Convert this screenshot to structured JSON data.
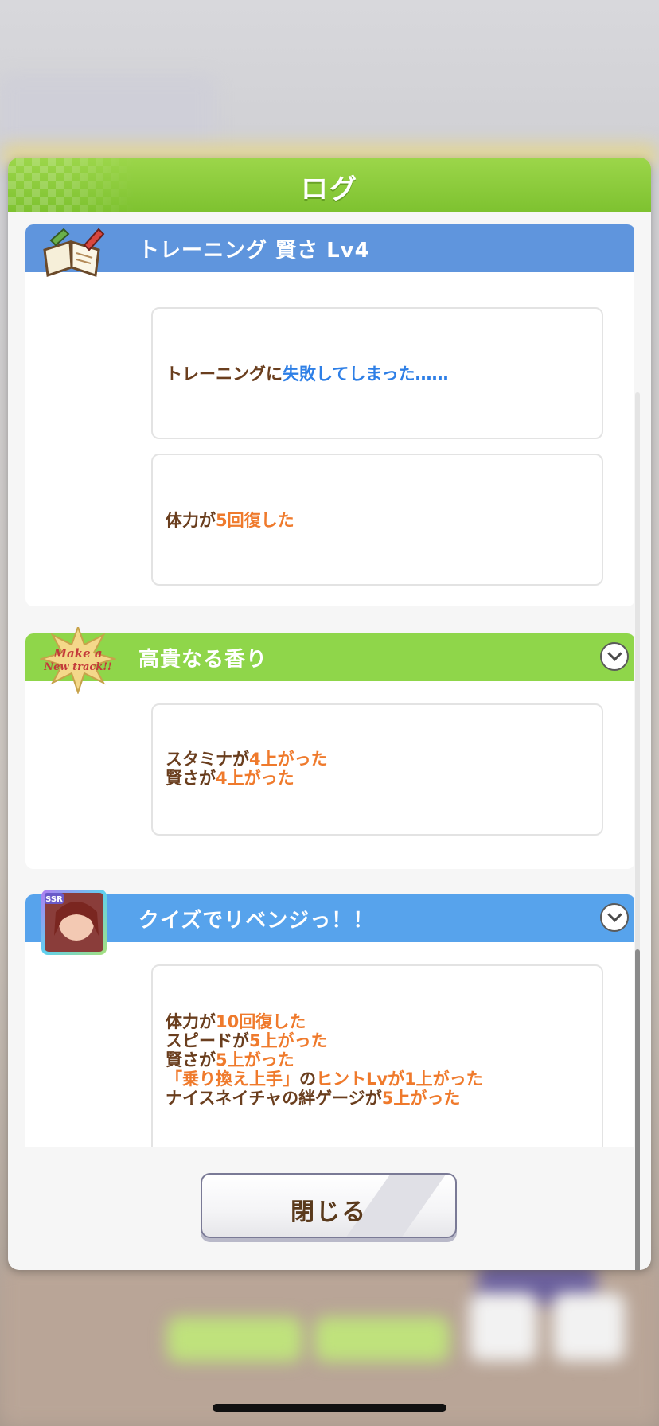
{
  "dialog": {
    "title": "ログ",
    "close_label": "閉じる"
  },
  "entries": [
    {
      "title": "トレーニング 賢さ Lv4",
      "header_color": "#5f95dd",
      "icon": "notebook-pencil-icon",
      "cards": [
        [
          [
            {
              "t": "トレーニングに",
              "c": "brown"
            },
            {
              "t": "失敗してしまった……",
              "c": "blue"
            }
          ]
        ],
        [
          [
            {
              "t": "体力が",
              "c": "brown"
            },
            {
              "t": "5回復した",
              "c": "orange"
            }
          ]
        ]
      ]
    },
    {
      "title": "高貴なる香り",
      "header_color": "#8fd64a",
      "icon": "make-a-new-track-badge-icon",
      "icon_text": "Make a New track!!",
      "cards": [
        [
          [
            {
              "t": "スタミナが",
              "c": "brown"
            },
            {
              "t": "4上がった",
              "c": "orange"
            }
          ],
          [
            {
              "t": "賢さが",
              "c": "brown"
            },
            {
              "t": "4上がった",
              "c": "orange"
            }
          ]
        ]
      ]
    },
    {
      "title": "クイズでリベンジっ！！",
      "header_color": "#57a3ec",
      "icon": "ssr-support-card-icon",
      "icon_badge": "SSR",
      "cards": [
        [
          [
            {
              "t": "体力が",
              "c": "brown"
            },
            {
              "t": "10回復した",
              "c": "orange"
            }
          ],
          [
            {
              "t": "スピードが",
              "c": "brown"
            },
            {
              "t": "5上がった",
              "c": "orange"
            }
          ],
          [
            {
              "t": "賢さが",
              "c": "brown"
            },
            {
              "t": "5上がった",
              "c": "orange"
            }
          ],
          [
            {
              "t": "「乗り換え上手」",
              "c": "orange"
            },
            {
              "t": "の",
              "c": "brown"
            },
            {
              "t": "ヒントLvが1上がった",
              "c": "orange"
            }
          ],
          [
            {
              "t": "ナイスネイチャの絆ゲージが",
              "c": "brown"
            },
            {
              "t": "5上がった",
              "c": "orange"
            }
          ]
        ]
      ]
    }
  ],
  "colors": {
    "brown": "#6a3e1e",
    "orange": "#ef7a2c",
    "blue": "#2e7fe6",
    "header_green": "#86c93a"
  }
}
